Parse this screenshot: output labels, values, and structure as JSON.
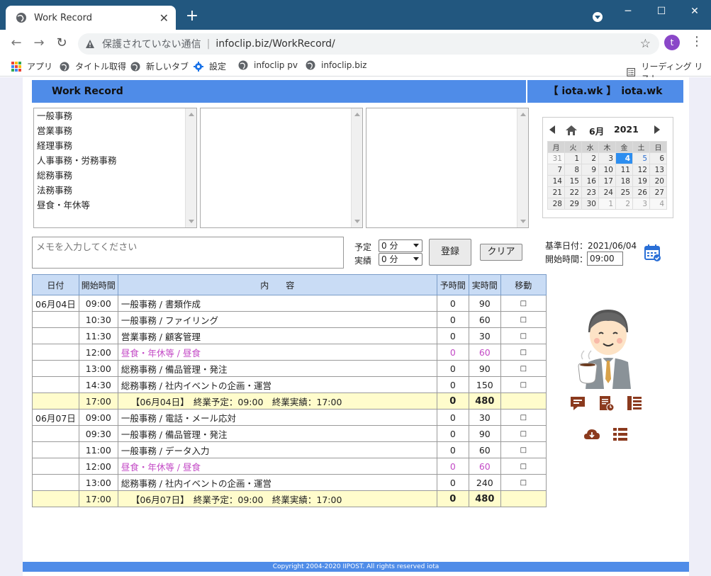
{
  "browser": {
    "tab_title": "Work Record",
    "insecure_label": "保護されていない通信",
    "url": "infoclip.biz/WorkRecord/",
    "avatar_letter": "t",
    "bookmarks": [
      "アプリ",
      "タイトル取得",
      "新しいタブ",
      "設定",
      "infoclip pv",
      "infoclip.biz"
    ],
    "reading_list": "リーディング リスト"
  },
  "header": {
    "app_title": "Work Record",
    "user_label": "【 iota.wk 】　iota.wk"
  },
  "category_list": [
    "一般事務",
    "営業事務",
    "経理事務",
    "人事事務・労務事務",
    "総務事務",
    "法務事務",
    "昼食・年休等"
  ],
  "calendar": {
    "month": "6月",
    "year": "2021",
    "weekdays": [
      "月",
      "火",
      "水",
      "木",
      "金",
      "土",
      "日"
    ],
    "weeks": [
      [
        "31",
        "1",
        "2",
        "3",
        "4",
        "5",
        "6"
      ],
      [
        "7",
        "8",
        "9",
        "10",
        "11",
        "12",
        "13"
      ],
      [
        "14",
        "15",
        "16",
        "17",
        "18",
        "19",
        "20"
      ],
      [
        "21",
        "22",
        "23",
        "24",
        "25",
        "26",
        "27"
      ],
      [
        "28",
        "29",
        "30",
        "1",
        "2",
        "3",
        "4"
      ]
    ],
    "selected_day": "4"
  },
  "form": {
    "memo_placeholder": "メモを入力してください",
    "yotei_label": "予定",
    "jisseki_label": "実績",
    "yotei_value": "0 分",
    "jisseki_value": "0 分",
    "register_label": "登録",
    "clear_label": "クリア",
    "base_date": "基準日付：2021/06/04",
    "start_time_label": "開始時間：",
    "start_time_value": "09:00"
  },
  "table": {
    "headers": [
      "日付",
      "開始時間",
      "内　　容",
      "予時間",
      "実時間",
      "移動"
    ],
    "move_symbol": "□",
    "rows": [
      {
        "date": "06月04日",
        "time": "09:00",
        "text": "一般事務 / 書類作成",
        "plan": "0",
        "actual": "90",
        "type": "normal"
      },
      {
        "date": "",
        "time": "10:30",
        "text": "一般事務 / ファイリング",
        "plan": "0",
        "actual": "60",
        "type": "normal"
      },
      {
        "date": "",
        "time": "11:30",
        "text": "営業事務 / 顧客管理",
        "plan": "0",
        "actual": "30",
        "type": "normal"
      },
      {
        "date": "",
        "time": "12:00",
        "text": "昼食・年休等 / 昼食",
        "plan": "0",
        "actual": "60",
        "type": "meal"
      },
      {
        "date": "",
        "time": "13:00",
        "text": "総務事務 / 備品管理・発注",
        "plan": "0",
        "actual": "90",
        "type": "normal"
      },
      {
        "date": "",
        "time": "14:30",
        "text": "総務事務 / 社内イベントの企画・運営",
        "plan": "0",
        "actual": "150",
        "type": "normal"
      },
      {
        "date": "",
        "time": "17:00",
        "text": "【06月04日】　終業予定：09:00　終業実績：17:00",
        "plan": "0",
        "actual": "480",
        "type": "total"
      },
      {
        "date": "06月07日",
        "time": "09:00",
        "text": "一般事務 / 電話・メール応対",
        "plan": "0",
        "actual": "30",
        "type": "normal"
      },
      {
        "date": "",
        "time": "09:30",
        "text": "一般事務 / 備品管理・発注",
        "plan": "0",
        "actual": "90",
        "type": "normal"
      },
      {
        "date": "",
        "time": "11:00",
        "text": "一般事務 / データ入力",
        "plan": "0",
        "actual": "60",
        "type": "normal"
      },
      {
        "date": "",
        "time": "12:00",
        "text": "昼食・年休等 / 昼食",
        "plan": "0",
        "actual": "60",
        "type": "meal"
      },
      {
        "date": "",
        "time": "13:00",
        "text": "総務事務 / 社内イベントの企画・運営",
        "plan": "0",
        "actual": "240",
        "type": "normal"
      },
      {
        "date": "",
        "time": "17:00",
        "text": "【06月07日】　終業予定：09:00　終業実績：17:00",
        "plan": "0",
        "actual": "480",
        "type": "total"
      }
    ]
  },
  "icons": {
    "accent_color": "#8b3a1e",
    "items": [
      "comment-icon",
      "report-icon",
      "list-icon",
      "download-icon",
      "menu-list-icon"
    ]
  },
  "footer": {
    "copyright": "Copyright 2004-2020 IIPOST. All rights reserved iota"
  },
  "colors": {
    "header_blue": "#4f8ce8",
    "table_header": "#c9dcf5",
    "total_row": "#fffccc",
    "meal_text": "#c34ac6",
    "today": "#2d8ef0"
  }
}
